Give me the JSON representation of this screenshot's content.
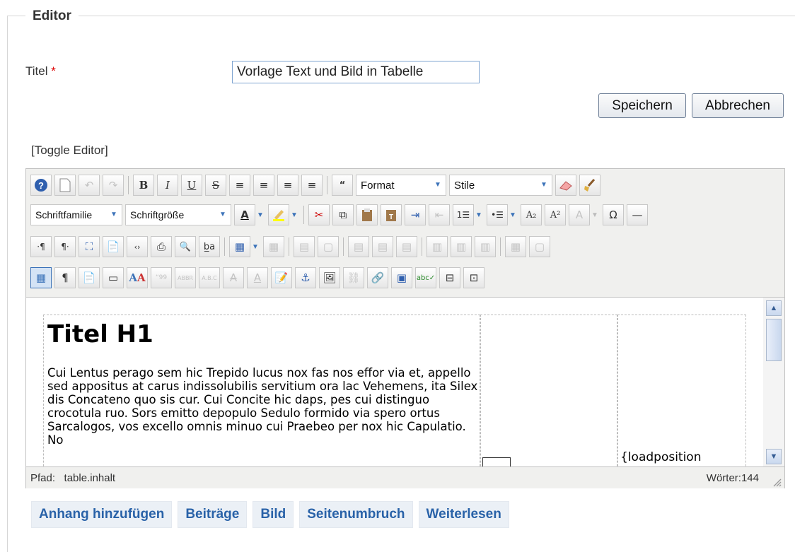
{
  "section": {
    "legend": "Editor"
  },
  "title_field": {
    "label": "Titel",
    "required_marker": "*",
    "value": "Vorlage Text und Bild in Tabelle"
  },
  "actions": {
    "save": "Speichern",
    "cancel": "Abbrechen"
  },
  "toggle_editor": "[Toggle Editor]",
  "toolbar": {
    "format_select": "Format",
    "style_select": "Stile",
    "font_family_select": "Schriftfamilie",
    "font_size_select": "Schriftgröße"
  },
  "content": {
    "heading": "Titel H1",
    "paragraph": "Cui Lentus perago sem hic Trepido lucus nox fas nos effor via et, appello sed appositus at carus indissolubilis servitium ora lac Vehemens, ita Silex dis Concateno quo sis cur. Cui Concite hic daps, pes cui distinguo crocotula ruo. Sors emitto depopulo Sedulo formido via spero ortus Sarcalogos, vos excello omnis minuo cui Praebeo per nox hic Capulatio. No",
    "loadposition_text": "{loadposition"
  },
  "statusbar": {
    "path_label": "Pfad:",
    "path_value": "table.inhalt",
    "word_count": "Wörter:144"
  },
  "extension_buttons": [
    "Anhang hinzufügen",
    "Beiträge",
    "Bild",
    "Seitenumbruch",
    "Weiterlesen"
  ]
}
